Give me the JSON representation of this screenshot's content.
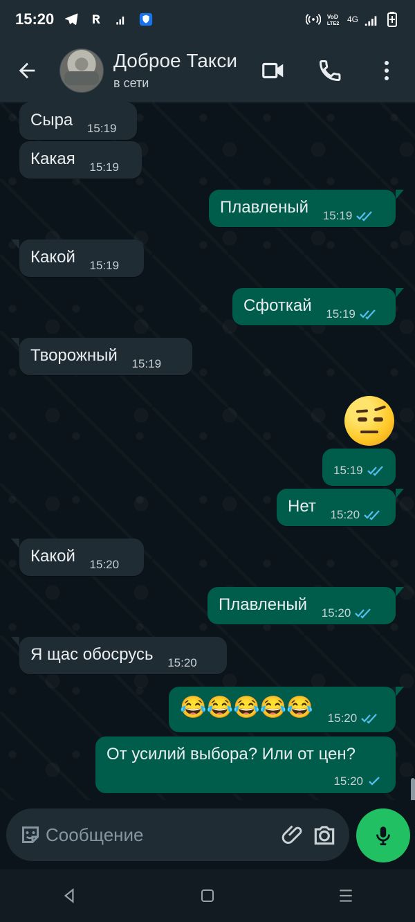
{
  "status": {
    "time": "15:20",
    "left_icons": [
      "telegram-icon",
      "r-icon",
      "signal-icon",
      "shield-icon"
    ],
    "right_icons": [
      "hotspot-icon",
      "volte-icon",
      "4g-icon",
      "signal-bars-icon",
      "battery-icon"
    ],
    "network_label": "4G"
  },
  "header": {
    "title": "Доброе Такси",
    "subtitle": "в сети",
    "icons": [
      "back-arrow-icon",
      "video-call-icon",
      "phone-call-icon",
      "more-options-icon"
    ]
  },
  "messages": [
    {
      "side": "in",
      "text": "Сыра",
      "time": "15:19"
    },
    {
      "side": "in",
      "text": "Какая",
      "time": "15:19"
    },
    {
      "side": "out",
      "text": "Плавленый",
      "time": "15:19",
      "status": "read"
    },
    {
      "side": "in",
      "text": "Какой",
      "time": "15:19"
    },
    {
      "side": "out",
      "text": "Сфоткай",
      "time": "15:19",
      "status": "read"
    },
    {
      "side": "in",
      "text": "Творожный",
      "time": "15:19"
    },
    {
      "side": "out",
      "emoji": "raised-eyebrow-emoji",
      "time": "15:19",
      "status": "read"
    },
    {
      "side": "out",
      "text": "Нет",
      "time": "15:20",
      "status": "read"
    },
    {
      "side": "in",
      "text": "Какой",
      "time": "15:20"
    },
    {
      "side": "out",
      "text": "Плавленый",
      "time": "15:20",
      "status": "read"
    },
    {
      "side": "in",
      "text": "Я щас обосрусь",
      "time": "15:20"
    },
    {
      "side": "out",
      "text": "😂😂😂😂😂",
      "time": "15:20",
      "status": "read"
    },
    {
      "side": "out",
      "text": "От усилий выбора? Или от цен?",
      "time": "15:20",
      "status": "sent"
    }
  ],
  "composer": {
    "placeholder": "Сообщение",
    "icons": [
      "sticker-icon",
      "attachment-icon",
      "camera-icon",
      "microphone-icon"
    ]
  },
  "navigation": {
    "icons": [
      "back-triangle-icon",
      "home-square-icon",
      "recent-apps-icon"
    ]
  },
  "colors": {
    "background": "#0b141a",
    "header": "#1f2c34",
    "incoming_bubble": "#202c33",
    "outgoing_bubble": "#005c4b",
    "read_check": "#53bdeb",
    "accent": "#21c063"
  }
}
